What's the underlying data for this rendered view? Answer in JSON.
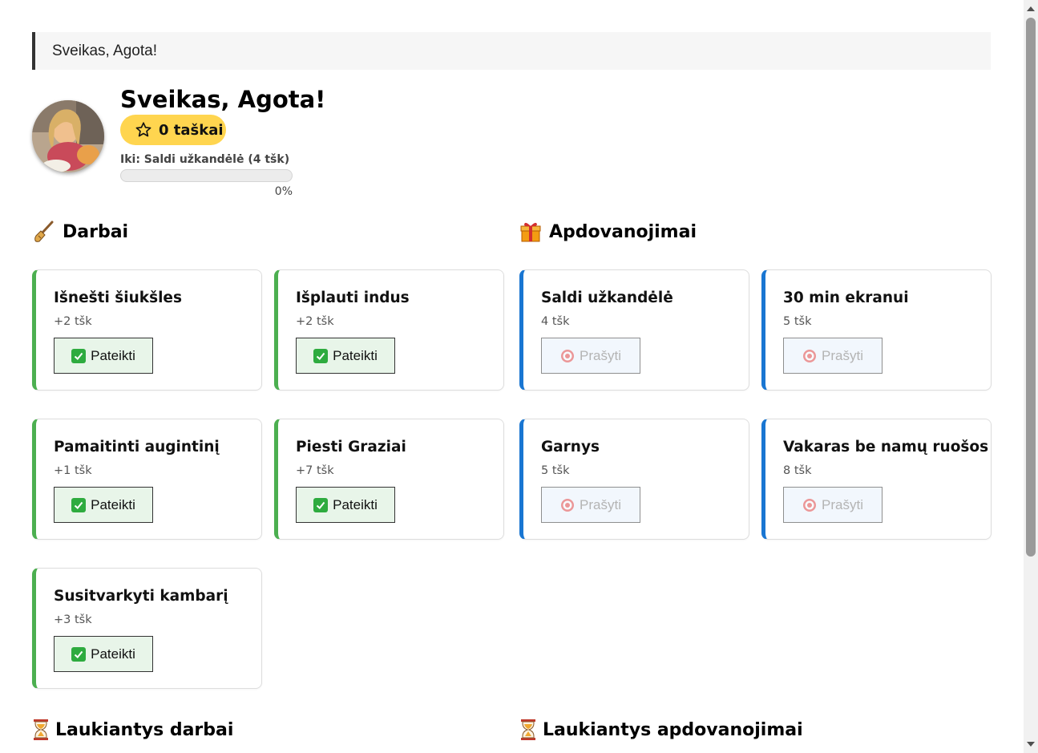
{
  "banner": {
    "text": "Sveikas, Agota!"
  },
  "profile": {
    "greeting": "Sveikas, Agota!",
    "points_label": "0 taškai",
    "progress_label": "Iki: Saldi užkandėlė (4 tšk)",
    "progress_percent_text": "0%",
    "progress_value": 0
  },
  "chores": {
    "title": "Darbai",
    "icon": "broom-icon",
    "items": [
      {
        "title": "Išnešti šiukšles",
        "points": "+2 tšk",
        "button": "Pateikti"
      },
      {
        "title": "Išplauti indus",
        "points": "+2 tšk",
        "button": "Pateikti"
      },
      {
        "title": "Pamaitinti augintinį",
        "points": "+1 tšk",
        "button": "Pateikti"
      },
      {
        "title": "Piesti Graziai",
        "points": "+7 tšk",
        "button": "Pateikti"
      },
      {
        "title": "Susitvarkyti kambarį",
        "points": "+3 tšk",
        "button": "Pateikti"
      }
    ]
  },
  "rewards": {
    "title": "Apdovanojimai",
    "icon": "gift-icon",
    "items": [
      {
        "title": "Saldi užkandėlė",
        "points": "4 tšk",
        "button": "Prašyti"
      },
      {
        "title": "30 min ekranui",
        "points": "5 tšk",
        "button": "Prašyti"
      },
      {
        "title": "Garnys",
        "points": "5 tšk",
        "button": "Prašyti"
      },
      {
        "title": "Vakaras be namų ruošos",
        "points": "8 tšk",
        "button": "Prašyti"
      }
    ]
  },
  "pending_chores": {
    "title": "Laukiantys darbai",
    "icon": "hourglass-icon"
  },
  "pending_rewards": {
    "title": "Laukiantys apdovanojimai",
    "icon": "hourglass-icon"
  },
  "colors": {
    "chore_accent": "#4caf50",
    "reward_accent": "#1976d2",
    "points_badge": "#ffd54f",
    "submit_bg": "#e8f5e9",
    "request_bg": "#f2f7fd"
  }
}
